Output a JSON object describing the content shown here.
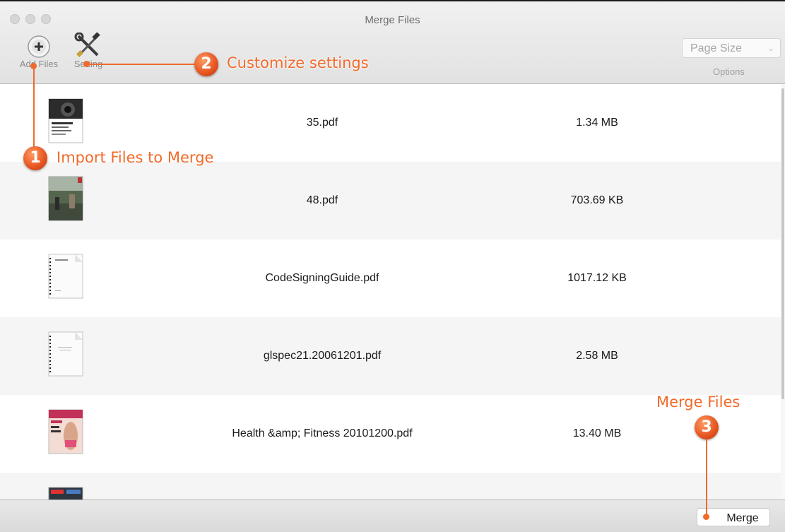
{
  "window": {
    "title": "Merge Files"
  },
  "toolbar": {
    "add_files_label": "Add Files",
    "setting_label": "Setting",
    "page_size_value": "Page Size",
    "options_label": "Options"
  },
  "files": [
    {
      "name": "35.pdf",
      "size": "1.34 MB",
      "thumb": "magazine-camera-thumbnail"
    },
    {
      "name": "48.pdf",
      "size": "703.69 KB",
      "thumb": "photo-street-thumbnail"
    },
    {
      "name": "CodeSigningGuide.pdf",
      "size": "1017.12 KB",
      "thumb": "document-page-thumbnail"
    },
    {
      "name": "glspec21.20061201.pdf",
      "size": "2.58 MB",
      "thumb": "document-page-thumbnail"
    },
    {
      "name": "Health &amp; Fitness 20101200.pdf",
      "size": "13.40 MB",
      "thumb": "magazine-cover-thumbnail"
    }
  ],
  "bottom": {
    "merge_label": "Merge"
  },
  "annotations": {
    "step1": {
      "number": "1",
      "text": "Import Files to Merge"
    },
    "step2": {
      "number": "2",
      "text": "Customize settings"
    },
    "step3": {
      "number": "3",
      "text": "Merge Files"
    }
  },
  "colors": {
    "annotation": "#f06a2a",
    "row_alt": "#f5f5f5"
  }
}
